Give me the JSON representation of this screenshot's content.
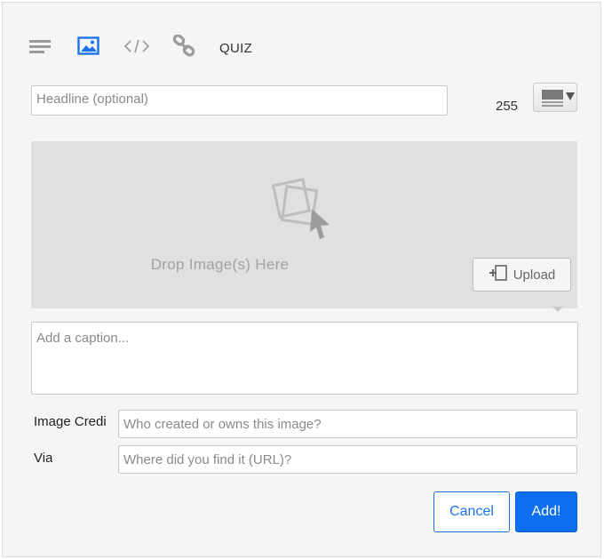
{
  "toolbar": {
    "items": [
      {
        "icon": "text-lines-icon",
        "active": false
      },
      {
        "icon": "image-icon",
        "active": true
      },
      {
        "icon": "code-icon",
        "active": false
      },
      {
        "icon": "link-icon",
        "active": false
      }
    ],
    "quiz_label": "QUIZ"
  },
  "headline": {
    "placeholder": "Headline (optional)",
    "value": "",
    "char_count": "255"
  },
  "layout_selector": {
    "icon": "image-layout-icon",
    "dropdown_icon": "triangle-down-icon"
  },
  "dropzone": {
    "icon": "drop-images-icon",
    "text": "Drop Image(s) Here",
    "upload_label": "Upload",
    "upload_icon": "add-file-icon"
  },
  "caption": {
    "placeholder": "Add a caption...",
    "value": ""
  },
  "credit": {
    "label": "Image Credi",
    "placeholder": "Who created or owns this image?",
    "value": ""
  },
  "via": {
    "label": "Via",
    "placeholder": "Where did you find it (URL)?",
    "value": ""
  },
  "actions": {
    "cancel_label": "Cancel",
    "add_label": "Add!"
  },
  "colors": {
    "accent": "#0d6ef0",
    "icon_gray": "#9a9a9a",
    "drop_bg": "#e0e0e0"
  }
}
